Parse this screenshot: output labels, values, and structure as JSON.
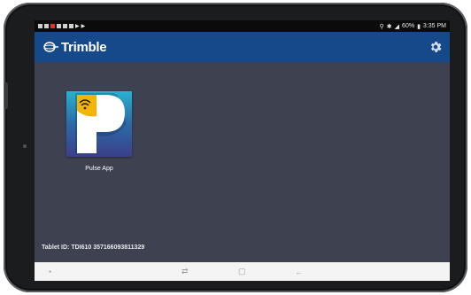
{
  "status_bar": {
    "battery": "60%",
    "time": "3:35 PM"
  },
  "app_bar": {
    "brand": "Trimble",
    "settings_icon": "gear-icon"
  },
  "apps": [
    {
      "label": "Pulse App",
      "icon": "pulse-app-icon"
    }
  ],
  "footer": {
    "tablet_id": "Tablet ID: TDI610 357166093811329"
  },
  "nav_bar": {
    "recent_icon": "recent-apps-icon",
    "home_icon": "home-icon",
    "back_icon": "back-icon"
  },
  "colors": {
    "app_bar": "#15498a",
    "background": "#3d4150",
    "nav_bar": "#f4f4f4"
  }
}
